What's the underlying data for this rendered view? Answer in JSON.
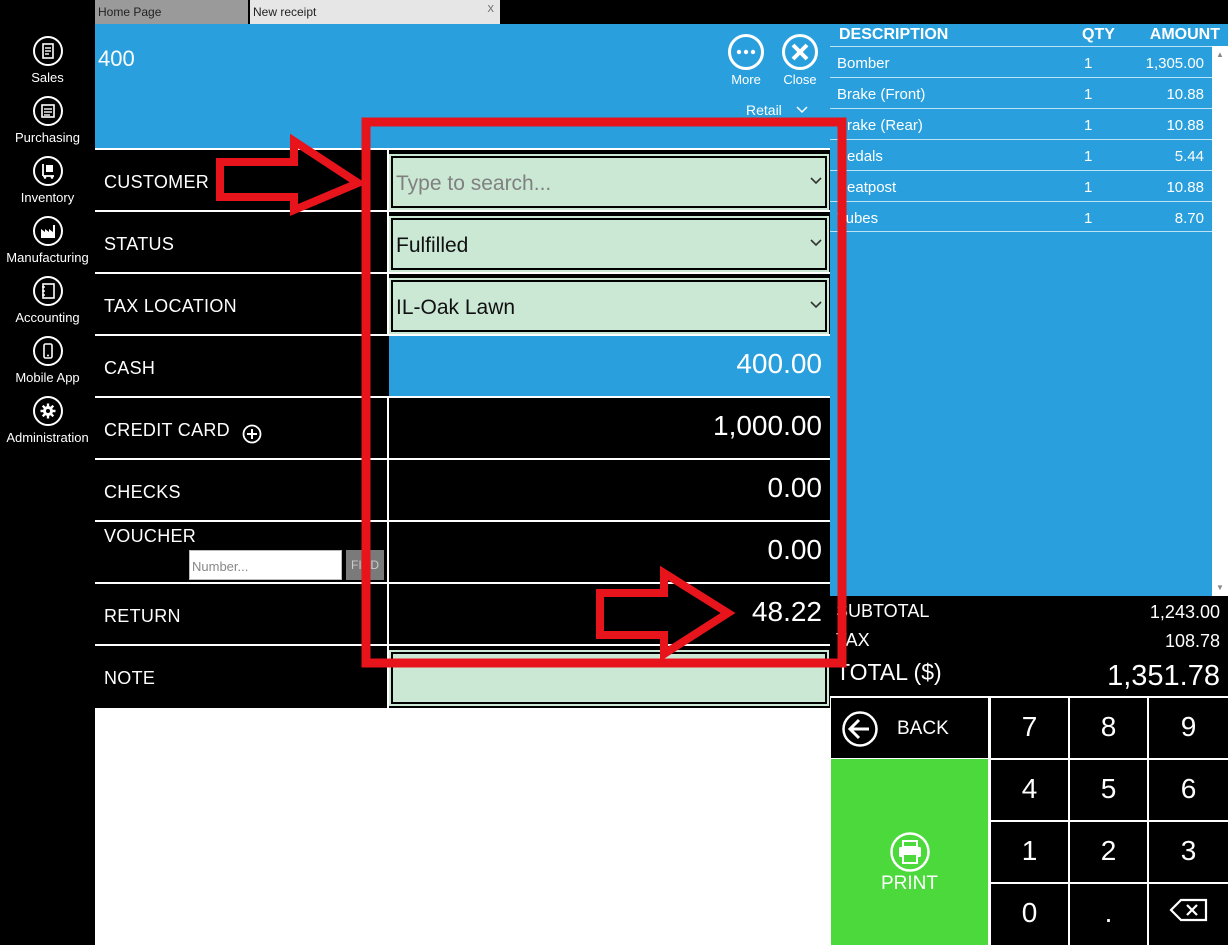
{
  "nav": {
    "items": [
      {
        "label": "Sales",
        "icon": "sales-icon"
      },
      {
        "label": "Purchasing",
        "icon": "purchasing-icon"
      },
      {
        "label": "Inventory",
        "icon": "inventory-icon"
      },
      {
        "label": "Manufacturing",
        "icon": "manufacturing-icon"
      },
      {
        "label": "Accounting",
        "icon": "accounting-icon"
      },
      {
        "label": "Mobile App",
        "icon": "mobile-icon"
      },
      {
        "label": "Administration",
        "icon": "gear-icon"
      }
    ]
  },
  "tabs": {
    "home": "Home Page",
    "new_receipt": "New receipt",
    "close": "x"
  },
  "header": {
    "title": "400",
    "more": "More",
    "close": "Close",
    "price_level": "Retail"
  },
  "form": {
    "customer": {
      "label": "CUSTOMER",
      "placeholder": "Type to search..."
    },
    "status": {
      "label": "STATUS",
      "value": "Fulfilled"
    },
    "tax_location": {
      "label": "TAX LOCATION",
      "value": "IL-Oak Lawn"
    },
    "cash": {
      "label": "CASH",
      "value": "400.00"
    },
    "credit_card": {
      "label": "CREDIT CARD",
      "value": "1,000.00"
    },
    "checks": {
      "label": "CHECKS",
      "value": "0.00"
    },
    "voucher": {
      "label": "VOUCHER",
      "value": "0.00",
      "input_placeholder": "Number...",
      "find": "FIND"
    },
    "return": {
      "label": "RETURN",
      "value": "48.22"
    },
    "note": {
      "label": "NOTE",
      "value": ""
    }
  },
  "receipt": {
    "headers": {
      "description": "DESCRIPTION",
      "qty": "QTY",
      "amount": "AMOUNT"
    },
    "items": [
      {
        "description": "Bomber",
        "qty": "1",
        "amount": "1,305.00"
      },
      {
        "description": "Brake (Front)",
        "qty": "1",
        "amount": "10.88"
      },
      {
        "description": "Brake (Rear)",
        "qty": "1",
        "amount": "10.88"
      },
      {
        "description": "Pedals",
        "qty": "1",
        "amount": "5.44"
      },
      {
        "description": "Seatpost",
        "qty": "1",
        "amount": "10.88"
      },
      {
        "description": "Tubes",
        "qty": "1",
        "amount": "8.70"
      }
    ]
  },
  "totals": {
    "subtotal_label": "SUBTOTAL",
    "subtotal": "1,243.00",
    "tax_label": "TAX",
    "tax": "108.78",
    "total_label": "TOTAL ($)",
    "total": "1,351.78"
  },
  "keypad": {
    "back": "BACK",
    "print": "PRINT",
    "keys": [
      "7",
      "8",
      "9",
      "4",
      "5",
      "6",
      "1",
      "2",
      "3",
      "0",
      "."
    ]
  },
  "colors": {
    "header_blue": "#29a0dd",
    "field_green": "#cbe8d5",
    "print_green": "#4cd93b",
    "annotation_red": "#e8141c"
  }
}
